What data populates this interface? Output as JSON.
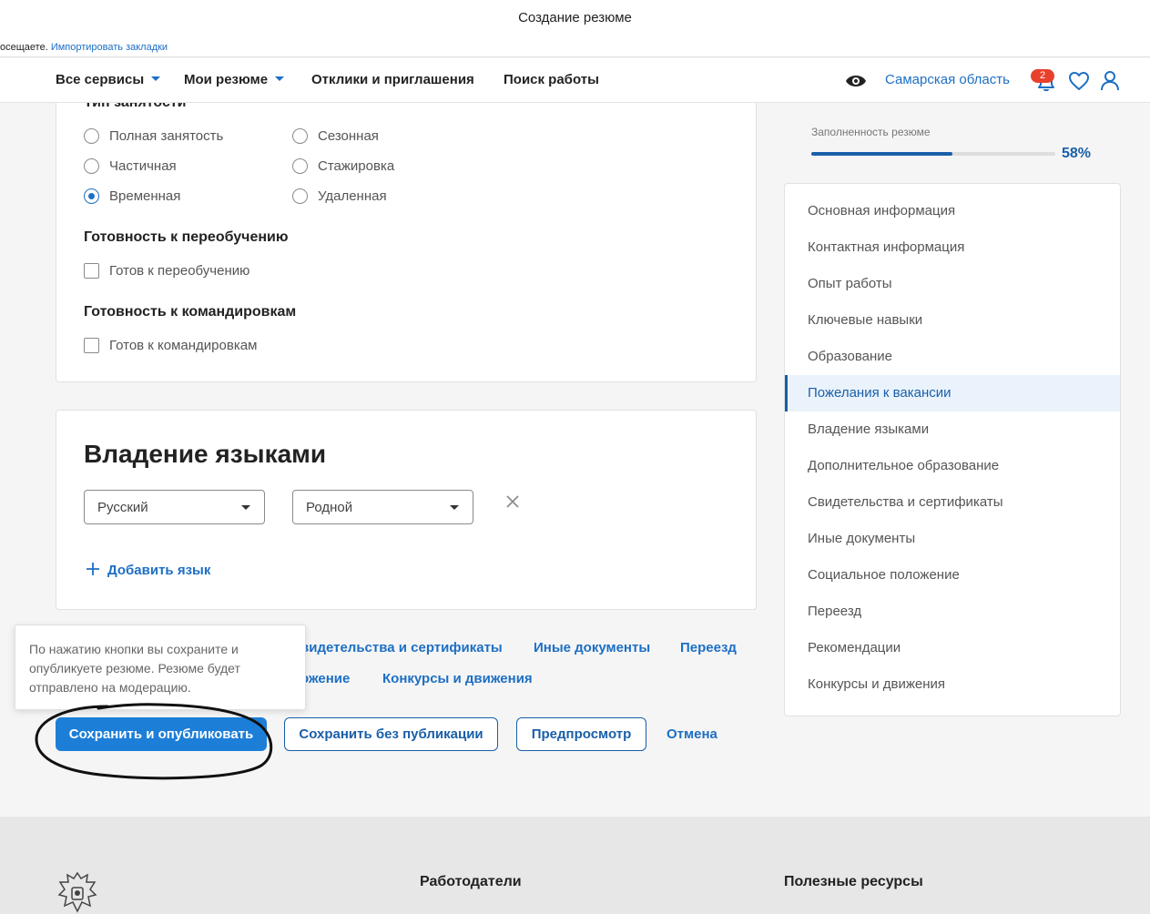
{
  "window": {
    "title": "Создание резюме"
  },
  "bookmarks_bar": {
    "prefix": "осещаете.",
    "link": "Импортировать закладки"
  },
  "nav": {
    "all_services": "Все сервисы",
    "my_resumes": "Мои резюме",
    "responses": "Отклики и приглашения",
    "job_search": "Поиск работы",
    "region": "Самарская область",
    "notifications_count": "2"
  },
  "employment": {
    "title": "Тип занятости",
    "options": [
      {
        "label": "Полная занятость",
        "checked": false
      },
      {
        "label": "Сезонная",
        "checked": false
      },
      {
        "label": "Частичная",
        "checked": false
      },
      {
        "label": "Стажировка",
        "checked": false
      },
      {
        "label": "Временная",
        "checked": true
      },
      {
        "label": "Удаленная",
        "checked": false
      }
    ]
  },
  "retraining": {
    "title": "Готовность к переобучению",
    "checkbox_label": "Готов к переобучению",
    "checked": false
  },
  "business_trips": {
    "title": "Готовность к командировкам",
    "checkbox_label": "Готов к командировкам",
    "checked": false
  },
  "languages": {
    "title": "Владение языками",
    "language_value": "Русский",
    "level_value": "Родной",
    "add_label": "Добавить язык"
  },
  "section_links": {
    "links": [
      "видетельства и сертификаты",
      "Иные документы",
      "Переезд",
      "ожение",
      "Конкурсы и движения"
    ]
  },
  "tooltip": {
    "text": "По нажатию кнопки вы сохраните и опубликуете резюме. Резюме будет отправлено на модерацию."
  },
  "actions": {
    "save_publish": "Сохранить и опубликовать",
    "save_no_publish": "Сохранить без публикации",
    "preview": "Предпросмотр",
    "cancel": "Отмена"
  },
  "progress": {
    "label": "Заполненность резюме",
    "percent_text": "58%",
    "value": 0.58
  },
  "sidebar": {
    "items": [
      {
        "label": "Основная информация",
        "active": false
      },
      {
        "label": "Контактная информация",
        "active": false
      },
      {
        "label": "Опыт работы",
        "active": false
      },
      {
        "label": "Ключевые навыки",
        "active": false
      },
      {
        "label": "Образование",
        "active": false
      },
      {
        "label": "Пожелания к вакансии",
        "active": true
      },
      {
        "label": "Владение языками",
        "active": false
      },
      {
        "label": "Дополнительное образование",
        "active": false
      },
      {
        "label": "Свидетельства и сертификаты",
        "active": false
      },
      {
        "label": "Иные документы",
        "active": false
      },
      {
        "label": "Социальное положение",
        "active": false
      },
      {
        "label": "Переезд",
        "active": false
      },
      {
        "label": "Рекомендации",
        "active": false
      },
      {
        "label": "Конкурсы и движения",
        "active": false
      }
    ]
  },
  "footer": {
    "employers": "Работодатели",
    "resources": "Полезные ресурсы"
  },
  "colors": {
    "accent": "#1d6fc4",
    "primary_button": "#1d7ed8",
    "badge": "#e8402c",
    "sidebar_active_bg": "#eaf3fb"
  }
}
